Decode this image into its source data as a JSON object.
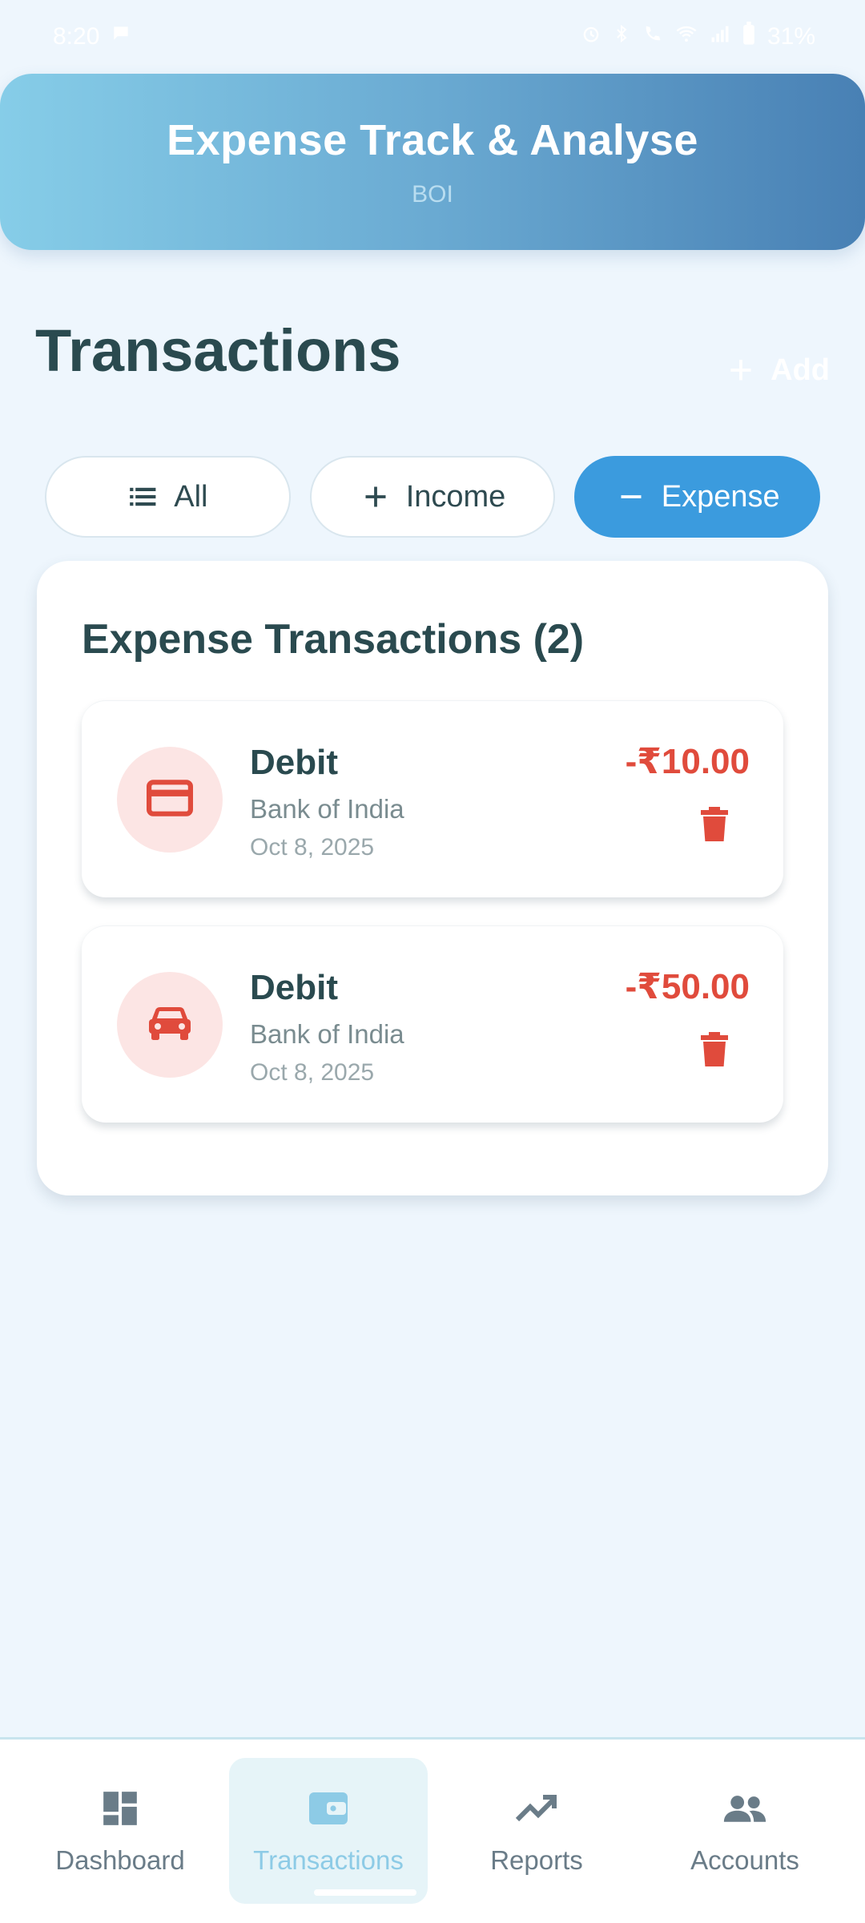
{
  "status_bar": {
    "time": "8:20",
    "battery": "31%"
  },
  "header": {
    "title": "Expense Track & Analyse",
    "subtitle": "BOI"
  },
  "page": {
    "title": "Transactions",
    "add_label": "Add"
  },
  "filters": [
    {
      "label": "All",
      "icon": "list-icon",
      "active": false
    },
    {
      "label": "Income",
      "icon": "plus-icon",
      "active": false
    },
    {
      "label": "Expense",
      "icon": "minus-icon",
      "active": true
    }
  ],
  "expense_card": {
    "title": "Expense Transactions (2)",
    "transactions": [
      {
        "type": "Debit",
        "bank": "Bank of India",
        "date": "Oct 8, 2025",
        "amount": "-₹10.00",
        "icon": "credit-card-icon"
      },
      {
        "type": "Debit",
        "bank": "Bank of India",
        "date": "Oct 8, 2025",
        "amount": "-₹50.00",
        "icon": "car-icon"
      }
    ]
  },
  "bottom_nav": [
    {
      "label": "Dashboard",
      "icon": "dashboard-icon",
      "active": false
    },
    {
      "label": "Transactions",
      "icon": "wallet-icon",
      "active": true
    },
    {
      "label": "Reports",
      "icon": "trending-up-icon",
      "active": false
    },
    {
      "label": "Accounts",
      "icon": "people-icon",
      "active": false
    }
  ],
  "colors": {
    "accent": "#3B9BDE",
    "expense_red": "#E04B3C",
    "header_start": "#86CDE8",
    "header_end": "#4880B4",
    "active_nav": "#8DCBE6"
  }
}
